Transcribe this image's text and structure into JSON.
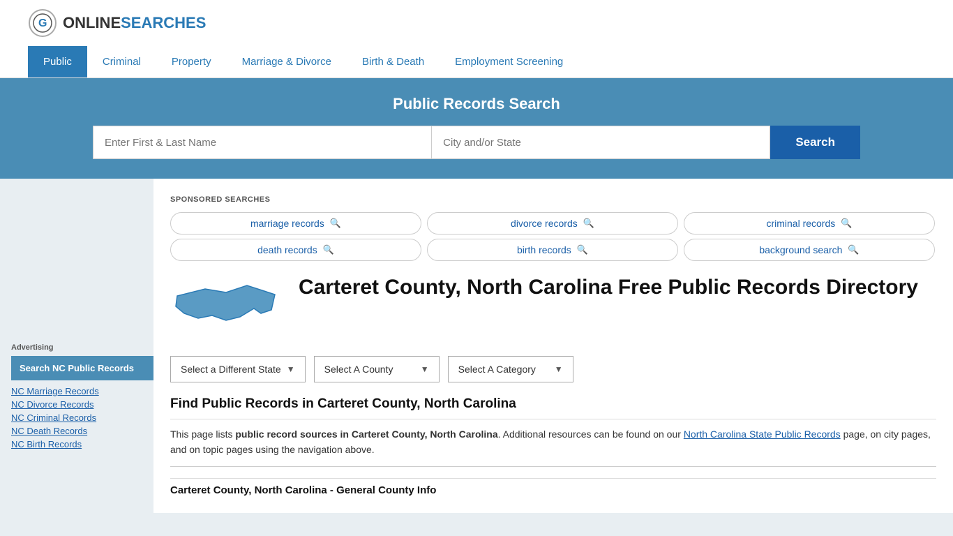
{
  "header": {
    "logo_text_online": "ONLINE",
    "logo_text_searches": "SEARCHES"
  },
  "nav": {
    "items": [
      {
        "label": "Public",
        "active": true
      },
      {
        "label": "Criminal",
        "active": false
      },
      {
        "label": "Property",
        "active": false
      },
      {
        "label": "Marriage & Divorce",
        "active": false
      },
      {
        "label": "Birth & Death",
        "active": false
      },
      {
        "label": "Employment Screening",
        "active": false
      }
    ]
  },
  "search_banner": {
    "title": "Public Records Search",
    "name_placeholder": "Enter First & Last Name",
    "location_placeholder": "City and/or State",
    "button_label": "Search"
  },
  "sponsored": {
    "label": "SPONSORED SEARCHES",
    "tags": [
      {
        "label": "marriage records"
      },
      {
        "label": "divorce records"
      },
      {
        "label": "criminal records"
      },
      {
        "label": "death records"
      },
      {
        "label": "birth records"
      },
      {
        "label": "background search"
      }
    ]
  },
  "county": {
    "title": "Carteret County, North Carolina Free Public Records Directory",
    "dropdowns": [
      {
        "label": "Select a Different State"
      },
      {
        "label": "Select A County"
      },
      {
        "label": "Select A Category"
      }
    ],
    "find_title": "Find Public Records in Carteret County, North Carolina",
    "find_text_1": "This page lists ",
    "find_text_bold": "public record sources in Carteret County, North Carolina",
    "find_text_2": ". Additional resources can be found on our ",
    "find_link": "North Carolina State Public Records",
    "find_text_3": " page, on city pages, and on topic pages using the navigation above.",
    "general_info_title": "Carteret County, North Carolina - General County Info"
  },
  "sidebar": {
    "ad_label": "Advertising",
    "ad_item": "Search NC Public Records",
    "links": [
      {
        "label": "NC Marriage Records"
      },
      {
        "label": "NC Divorce Records"
      },
      {
        "label": "NC Criminal Records"
      },
      {
        "label": "NC Death Records"
      },
      {
        "label": "NC Birth Records"
      }
    ]
  }
}
